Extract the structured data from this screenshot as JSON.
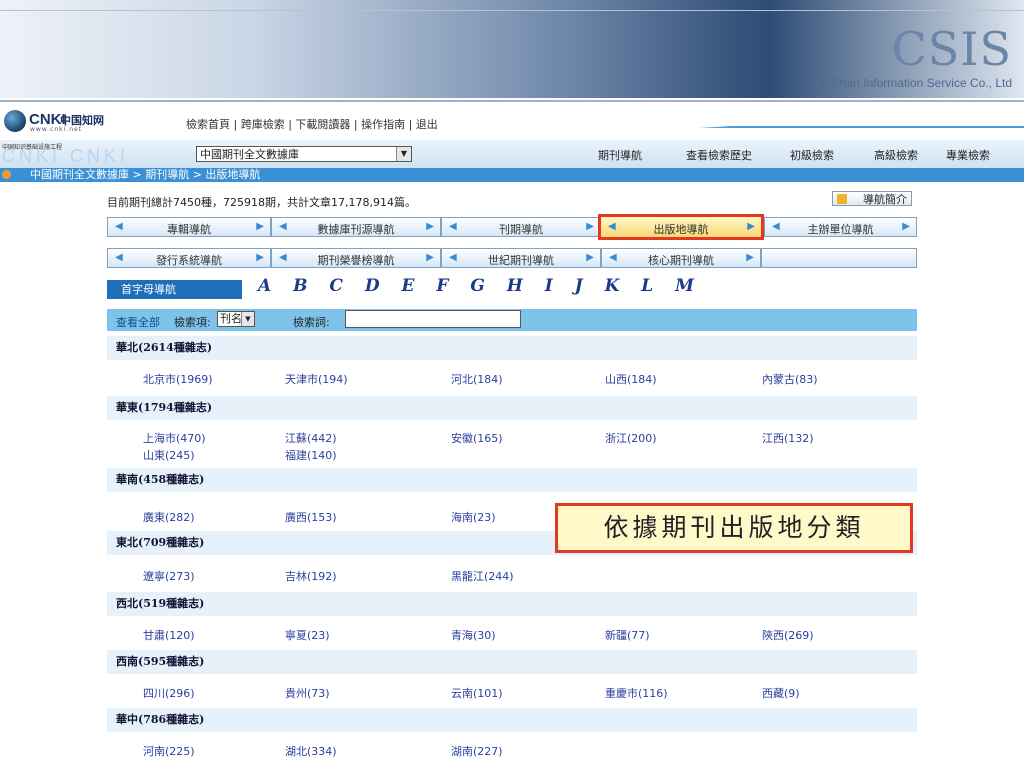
{
  "banner": {
    "logo": "CSIS",
    "tagline": "Chin Shan Information Service Co., Ltd"
  },
  "cnki": {
    "brand": "CNKI",
    "cn": "中国知网",
    "www": "www.cnki.net"
  },
  "toplinks": [
    "檢索首頁",
    "跨庫檢索",
    "下載閱讀器",
    "操作指南",
    "退出"
  ],
  "nav": {
    "org": "中国知识基础设施工程",
    "db_select": "中國期刊全文數據庫",
    "tabs": [
      "期刊導航",
      "查看檢索歷史",
      "初級檢索",
      "高級檢索",
      "專業檢索"
    ]
  },
  "breadcrumb": "中國期刊全文數據庫 > 期刊導航 > 出版地導航",
  "stats": "目前期刊總計7450種，725918期，共計文章17,178,914篇。",
  "intro_button": "導航簡介",
  "nav_tabs_row1": [
    "專輯導航",
    "數據庫刊源導航",
    "刊期導航",
    "出版地導航",
    "主辦單位導航"
  ],
  "nav_tabs_row2": [
    "發行系統導航",
    "期刊榮譽榜導航",
    "世紀期刊導航",
    "核心期刊導航"
  ],
  "alpha": {
    "label": "首字母導航",
    "letters": "A B C D E F G H I J K L M"
  },
  "search": {
    "all": "查看全部",
    "field_label": "檢索項:",
    "field_value": "刊名",
    "term_label": "檢索詞:"
  },
  "regions": [
    {
      "name": "華北(2614種雜志)",
      "provinces": [
        "北京市(1969)",
        "天津市(194)",
        "河北(184)",
        "山西(184)",
        "內蒙古(83)"
      ]
    },
    {
      "name": "華東(1794種雜志)",
      "provinces": [
        "上海市(470)",
        "江蘇(442)",
        "安徽(165)",
        "浙江(200)",
        "江西(132)",
        "山東(245)",
        "福建(140)"
      ]
    },
    {
      "name": "華南(458種雜志)",
      "provinces": [
        "廣東(282)",
        "廣西(153)",
        "海南(23)"
      ]
    },
    {
      "name": "東北(709種雜志)",
      "provinces": [
        "遼寧(273)",
        "吉林(192)",
        "黑龍江(244)"
      ]
    },
    {
      "name": "西北(519種雜志)",
      "provinces": [
        "甘肅(120)",
        "寧夏(23)",
        "青海(30)",
        "新疆(77)",
        "陝西(269)"
      ]
    },
    {
      "name": "西南(595種雜志)",
      "provinces": [
        "四川(296)",
        "貴州(73)",
        "云南(101)",
        "重慶市(116)",
        "西藏(9)"
      ]
    },
    {
      "name": "華中(786種雜志)",
      "provinces": [
        "河南(225)",
        "湖北(334)",
        "湖南(227)"
      ]
    }
  ],
  "callout": "依據期刊出版地分類"
}
